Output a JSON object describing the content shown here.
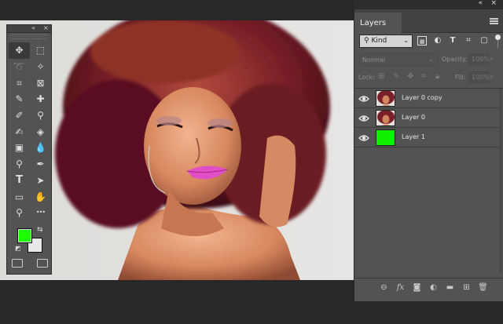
{
  "colors": {
    "foreground": "#1dff00",
    "background": "#e9e7ea",
    "layer1_fill": "#10f000",
    "panel_bg": "#535353",
    "app_bg": "#282828"
  },
  "tools_panel": {
    "collapse_glyph": "«",
    "close_glyph": "×",
    "tools": [
      {
        "name": "move-tool",
        "icon": "move-icon",
        "glyph": "✥",
        "active": true
      },
      {
        "name": "marquee-tool",
        "icon": "rect-marquee-icon",
        "glyph": "⬚"
      },
      {
        "name": "lasso-tool",
        "icon": "lasso-icon",
        "glyph": "➰"
      },
      {
        "name": "magic-wand-tool",
        "icon": "magic-wand-icon",
        "glyph": "✧"
      },
      {
        "name": "crop-tool",
        "icon": "crop-icon",
        "glyph": "⌗"
      },
      {
        "name": "frame-tool",
        "icon": "frame-icon",
        "glyph": "⊠"
      },
      {
        "name": "eyedropper-tool",
        "icon": "eyedropper-icon",
        "glyph": "✎"
      },
      {
        "name": "healing-tool",
        "icon": "band-aid-icon",
        "glyph": "✚"
      },
      {
        "name": "brush-tool",
        "icon": "brush-icon",
        "glyph": "✐"
      },
      {
        "name": "stamp-tool",
        "icon": "stamp-icon",
        "glyph": "⚲"
      },
      {
        "name": "history-brush-tool",
        "icon": "history-brush-icon",
        "glyph": "✍"
      },
      {
        "name": "eraser-tool",
        "icon": "eraser-icon",
        "glyph": "◈"
      },
      {
        "name": "gradient-tool",
        "icon": "gradient-icon",
        "glyph": "▣"
      },
      {
        "name": "blur-tool",
        "icon": "drop-icon",
        "glyph": "💧"
      },
      {
        "name": "dodge-tool",
        "icon": "dodge-icon",
        "glyph": "⚲"
      },
      {
        "name": "pen-tool",
        "icon": "pen-icon",
        "glyph": "✒"
      },
      {
        "name": "type-tool",
        "icon": "type-icon",
        "glyph": "T"
      },
      {
        "name": "path-select-tool",
        "icon": "arrow-icon",
        "glyph": "➤"
      },
      {
        "name": "shape-tool",
        "icon": "rectangle-icon",
        "glyph": "▭"
      },
      {
        "name": "hand-tool",
        "icon": "hand-icon",
        "glyph": "✋"
      },
      {
        "name": "zoom-tool",
        "icon": "zoom-icon",
        "glyph": "⚲"
      },
      {
        "name": "more-tools",
        "icon": "ellipsis-icon",
        "glyph": "•••"
      }
    ],
    "swap_glyph": "⇆",
    "default_glyph": "◩"
  },
  "layers_panel": {
    "collapse_glyph": "«",
    "close_glyph": "×",
    "tab_label": "Layers",
    "filter": {
      "kind_label": "Kind"
    },
    "blend_mode": "Normal",
    "opacity_label": "Opacity:",
    "opacity_value": "100%",
    "lock_label": "Lock:",
    "fill_label": "Fill:",
    "fill_value": "100%",
    "layers": [
      {
        "name": "Layer 0 copy",
        "visible": true,
        "thumb": "photo"
      },
      {
        "name": "Layer 0",
        "visible": true,
        "thumb": "photo"
      },
      {
        "name": "Layer 1",
        "visible": true,
        "thumb": "solid"
      }
    ],
    "bottom_icons": [
      "link-icon",
      "fx-icon",
      "mask-icon",
      "adjustment-icon",
      "folder-icon",
      "new-layer-icon",
      "trash-icon"
    ],
    "fx_label": "fx"
  }
}
